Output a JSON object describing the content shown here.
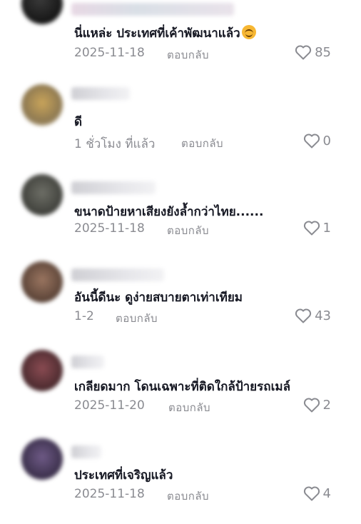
{
  "reply_label": "ตอบกลับ",
  "comments": [
    {
      "text": "นี่แหล่ะ ประเทศที่เค้าพัฒนาแล้ว",
      "date": "2025-11-18",
      "likes": "85",
      "has_emoji": true
    },
    {
      "text": "ดี",
      "date": "1 ชั่วโมง ที่แล้ว",
      "likes": "0"
    },
    {
      "text": "ขนาดป้ายหาเสียงยังล้ำกว่าไทย......",
      "date": "2025-11-18",
      "likes": "1"
    },
    {
      "text": "อันนี้ดีนะ ดูง่ายสบายตาเท่าเทียม",
      "date": "1-2",
      "likes": "43"
    },
    {
      "text": "เกลียดมาก โดนเฉพาะที่ติดใกล้ป้ายรถเมล์",
      "date": "2025-11-20",
      "likes": "2"
    },
    {
      "text": "ประเทศที่เจริญแล้ว",
      "date": "2025-11-18",
      "likes": "4"
    }
  ],
  "colors": {
    "text": "#161823",
    "muted": "#8a8b91"
  },
  "icons": {
    "like": "heart-outline-icon",
    "emoji": "smiling-face-emoji-icon"
  }
}
